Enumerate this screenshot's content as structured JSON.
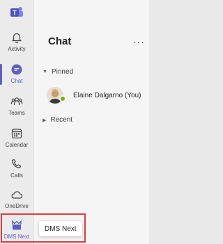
{
  "rail": {
    "items": [
      {
        "label": "Activity",
        "icon": "bell-icon"
      },
      {
        "label": "Chat",
        "icon": "chat-icon"
      },
      {
        "label": "Teams",
        "icon": "teams-icon"
      },
      {
        "label": "Calendar",
        "icon": "calendar-icon"
      },
      {
        "label": "Calls",
        "icon": "phone-icon"
      },
      {
        "label": "OneDrive",
        "icon": "cloud-icon"
      },
      {
        "label": "DMS Next",
        "icon": "dms-next-icon"
      }
    ],
    "active": "Chat"
  },
  "panel": {
    "title": "Chat",
    "more": "···",
    "sections": [
      {
        "label": "Pinned",
        "expanded": true
      },
      {
        "label": "Recent",
        "expanded": false
      }
    ],
    "pinned_chat": {
      "name": "Elaine Dalgarno (You)",
      "presence": "available"
    }
  },
  "tooltip": {
    "text": "DMS Next"
  },
  "colors": {
    "accent": "#5b5fc7",
    "highlight": "#e23b3b",
    "presence": "#6bb700"
  }
}
